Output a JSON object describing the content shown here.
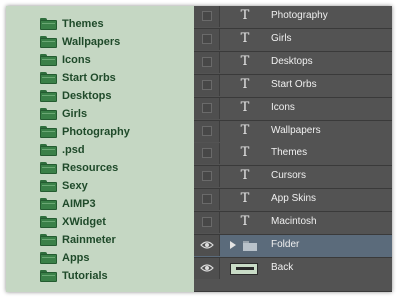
{
  "folders_panel": {
    "items": [
      {
        "label": "Themes"
      },
      {
        "label": "Wallpapers"
      },
      {
        "label": "Icons"
      },
      {
        "label": "Start Orbs"
      },
      {
        "label": "Desktops"
      },
      {
        "label": "Girls"
      },
      {
        "label": "Photography"
      },
      {
        "label": ".psd"
      },
      {
        "label": "Resources"
      },
      {
        "label": "Sexy"
      },
      {
        "label": "AIMP3"
      },
      {
        "label": "XWidget"
      },
      {
        "label": "Rainmeter"
      },
      {
        "label": "Apps"
      },
      {
        "label": "Tutorials"
      }
    ]
  },
  "layers_panel": {
    "text_layers": [
      {
        "label": "Photography",
        "icon": "text-layer-icon"
      },
      {
        "label": "Girls",
        "icon": "text-layer-icon"
      },
      {
        "label": "Desktops",
        "icon": "text-layer-icon"
      },
      {
        "label": "Start Orbs",
        "icon": "text-layer-icon"
      },
      {
        "label": "Icons",
        "icon": "text-layer-icon"
      },
      {
        "label": "Wallpapers",
        "icon": "text-layer-icon"
      },
      {
        "label": "Themes",
        "icon": "text-layer-icon"
      },
      {
        "label": "Cursors",
        "icon": "text-layer-icon"
      },
      {
        "label": "App Skins",
        "icon": "text-layer-icon"
      },
      {
        "label": "Macintosh",
        "icon": "text-layer-icon"
      }
    ],
    "text_glyph": "T",
    "folder_layer": {
      "label": "Folder"
    },
    "back_layer": {
      "label": "Back"
    }
  },
  "colors": {
    "left_panel_bg": "#c5d7c3",
    "folder_green": "#3a8048",
    "layers_bg": "#535353",
    "selected_layer_bg": "#5b6b7b"
  }
}
